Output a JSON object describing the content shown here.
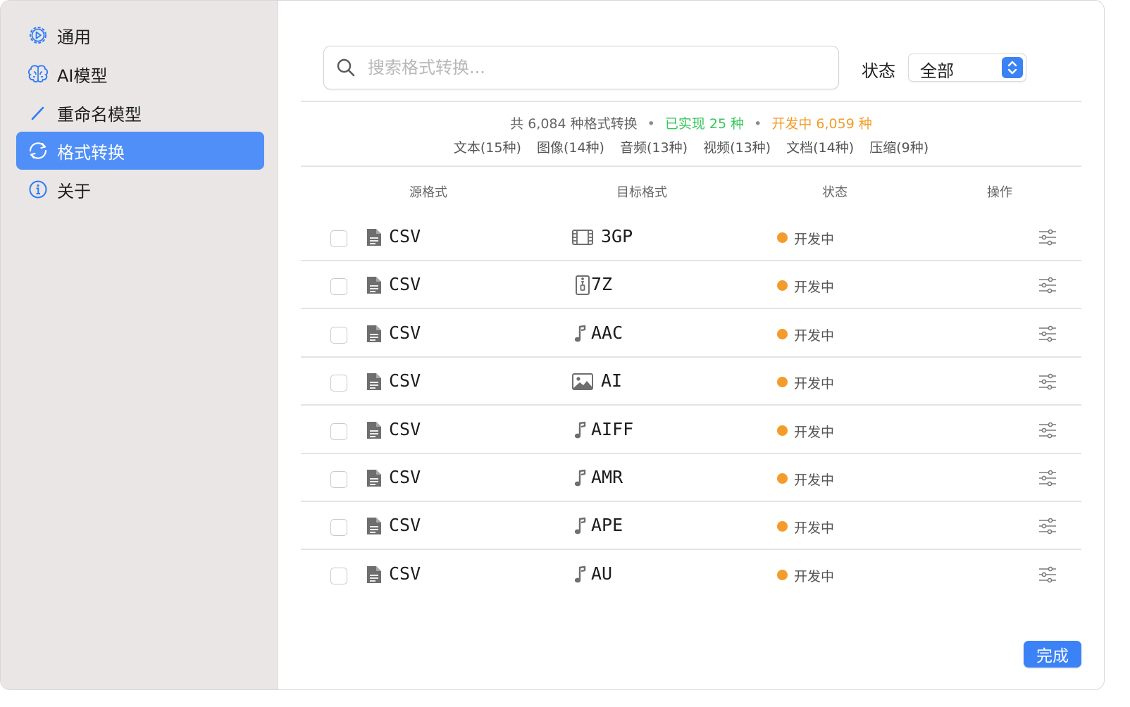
{
  "sidebar": {
    "items": [
      {
        "label": "通用",
        "icon": "gear-icon",
        "active": false
      },
      {
        "label": "AI模型",
        "icon": "brain-icon",
        "active": false
      },
      {
        "label": "重命名模型",
        "icon": "pencil-icon",
        "active": false
      },
      {
        "label": "格式转换",
        "icon": "sync-icon",
        "active": true
      },
      {
        "label": "关于",
        "icon": "info-icon",
        "active": false
      }
    ]
  },
  "search": {
    "placeholder": "搜索格式转换...",
    "value": ""
  },
  "status_filter": {
    "label": "状态",
    "value": "全部"
  },
  "summary": {
    "total": "共 6,084 种格式转换",
    "separator": "•",
    "implemented": "已实现 25 种",
    "in_dev": "开发中 6,059 种"
  },
  "categories": [
    "文本(15种)",
    "图像(14种)",
    "音频(13种)",
    "视频(13种)",
    "文档(14种)",
    "压缩(9种)"
  ],
  "table": {
    "headers": {
      "source": "源格式",
      "target": "目标格式",
      "status": "状态",
      "action": "操作"
    },
    "rows": [
      {
        "source": "CSV",
        "target": "3GP",
        "target_icon": "film-icon",
        "status": "开发中"
      },
      {
        "source": "CSV",
        "target": "7Z",
        "target_icon": "archive-icon",
        "status": "开发中"
      },
      {
        "source": "CSV",
        "target": "AAC",
        "target_icon": "music-note-icon",
        "status": "开发中"
      },
      {
        "source": "CSV",
        "target": "AI",
        "target_icon": "image-icon",
        "status": "开发中"
      },
      {
        "source": "CSV",
        "target": "AIFF",
        "target_icon": "music-note-icon",
        "status": "开发中"
      },
      {
        "source": "CSV",
        "target": "AMR",
        "target_icon": "music-note-icon",
        "status": "开发中"
      },
      {
        "source": "CSV",
        "target": "APE",
        "target_icon": "music-note-icon",
        "status": "开发中"
      },
      {
        "source": "CSV",
        "target": "AU",
        "target_icon": "music-note-icon",
        "status": "开发中"
      }
    ]
  },
  "colors": {
    "accent": "#3b82f6",
    "sidebar_active": "#4f8ff7",
    "implemented": "#34c759",
    "in_dev": "#f39c2b"
  },
  "footer": {
    "done_label": "完成"
  }
}
